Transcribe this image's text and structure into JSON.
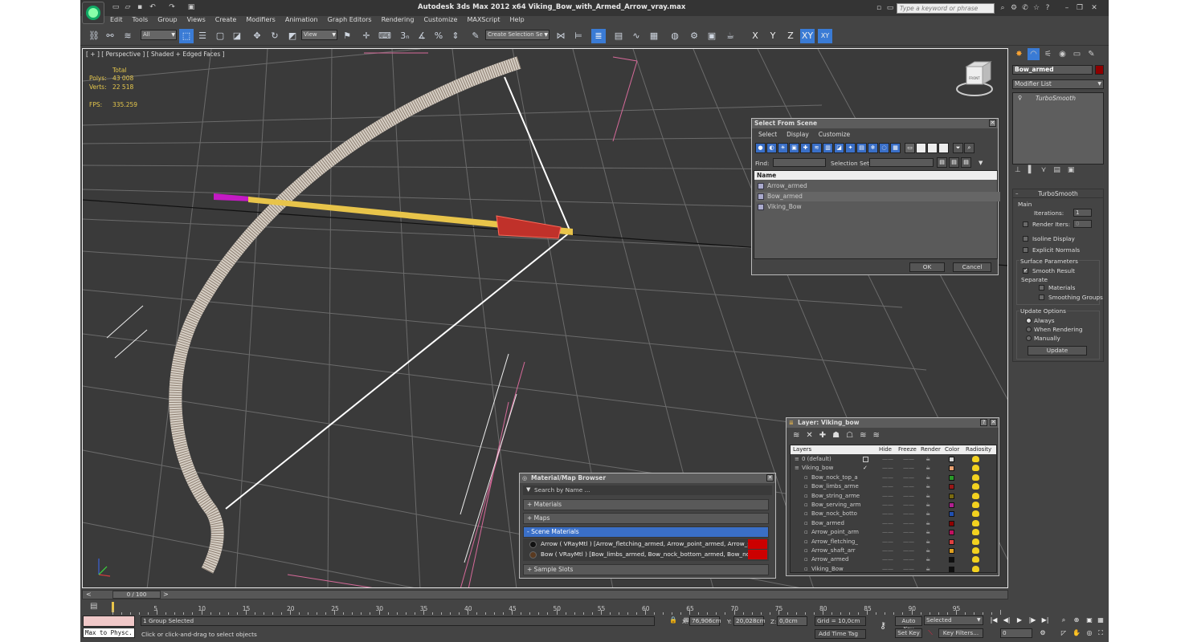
{
  "title": "Autodesk 3ds Max  2012 x64     Viking_Bow_with_Armed_Arrow_vray.max",
  "search_placeholder": "Type a keyword or phrase",
  "menu": [
    "Edit",
    "Tools",
    "Group",
    "Views",
    "Create",
    "Modifiers",
    "Animation",
    "Graph Editors",
    "Rendering",
    "Customize",
    "MAXScript",
    "Help"
  ],
  "toolbar": {
    "selection_filter": "All",
    "ref_coord": "View",
    "named_selection": "Create Selection Se",
    "axes": [
      "X",
      "Y",
      "Z",
      "XY",
      "XY"
    ]
  },
  "viewport": {
    "label": "[ + ] [ Perspective ] [ Shaded + Edged Faces ]",
    "stats_header": "Total",
    "polys_label": "Polys:",
    "polys_value": "43 008",
    "verts_label": "Verts:",
    "verts_value": "22 518",
    "fps_label": "FPS:",
    "fps_value": "335.259",
    "viewcube_label": "FRONT"
  },
  "command_panel": {
    "object_name": "Bow_armed",
    "object_color": "#8e0000",
    "modifier_list": "Modifier List",
    "stack_item": "TurboSmooth",
    "rollout_title": "TurboSmooth",
    "main": "Main",
    "iterations_label": "Iterations:",
    "iterations_value": "1",
    "render_iters_label": "Render Iters:",
    "render_iters_value": "0",
    "isoline": "Isoline Display",
    "explicit": "Explicit Normals",
    "surface_params": "Surface Parameters",
    "smooth_result": "Smooth Result",
    "separate": "Separate",
    "materials": "Materials",
    "smoothing_groups": "Smoothing Groups",
    "update_options": "Update Options",
    "always": "Always",
    "when_rendering": "When Rendering",
    "manually": "Manually",
    "update_button": "Update"
  },
  "select_from_scene": {
    "title": "Select From Scene",
    "menu": [
      "Select",
      "Display",
      "Customize"
    ],
    "find_label": "Find:",
    "selection_set_label": "Selection Set:",
    "name_header": "Name",
    "items": [
      "Arrow_armed",
      "Bow_armed",
      "Viking_Bow"
    ],
    "ok": "OK",
    "cancel": "Cancel"
  },
  "layer_dialog": {
    "title": "Layer: Viking_bow",
    "headers": [
      "Layers",
      "Hide",
      "Freeze",
      "Render",
      "Color",
      "Radiosity"
    ],
    "rows": [
      {
        "name": "0 (default)",
        "color": "#d4d4d4",
        "dash": "——"
      },
      {
        "name": "Viking_bow",
        "color": "#e8a070",
        "dash": "——"
      },
      {
        "name": "Bow_nock_top_a",
        "color": "#2a9a2a",
        "dash": "——"
      },
      {
        "name": "Bow_limbs_arme",
        "color": "#9a1818",
        "dash": "——"
      },
      {
        "name": "Bow_string_arme",
        "color": "#7a6a10",
        "dash": "——"
      },
      {
        "name": "Bow_serving_arm",
        "color": "#b02090",
        "dash": "——"
      },
      {
        "name": "Bow_nock_botto",
        "color": "#2050b0",
        "dash": "——"
      },
      {
        "name": "Bow_armed",
        "color": "#8e0000",
        "dash": "——"
      },
      {
        "name": "Arrow_point_arm",
        "color": "#c01060",
        "dash": "——"
      },
      {
        "name": "Arrow_fletching_",
        "color": "#e04040",
        "dash": "——"
      },
      {
        "name": "Arrow_shaft_arr",
        "color": "#e0a020",
        "dash": "——"
      },
      {
        "name": "Arrow_armed",
        "color": "#101010",
        "dash": "——"
      },
      {
        "name": "Viking_Bow",
        "color": "#101010",
        "dash": "——"
      }
    ]
  },
  "material_browser": {
    "title": "Material/Map Browser",
    "search": "Search by Name ...",
    "materials": "+ Materials",
    "maps": "+ Maps",
    "scene_materials": "- Scene Materials",
    "mat1": "Arrow  ( VRayMtl )  [Arrow_fletching_armed, Arrow_point_armed, Arrow_shaft_a...",
    "mat2": "Bow  ( VRayMtl )  [Bow_limbs_armed, Bow_nock_bottom_armed, Bow_nock_top...",
    "sample_slots": "+ Sample Slots"
  },
  "timeline": {
    "slider": "0 / 100",
    "ticks": [
      "5",
      "10",
      "15",
      "20",
      "25",
      "30",
      "35",
      "40",
      "45",
      "50",
      "55",
      "60",
      "65",
      "70",
      "75",
      "80",
      "85",
      "90",
      "95"
    ]
  },
  "status": {
    "listener": "Max to Physc.",
    "selection": "1 Group Selected",
    "prompt": "Click or click-and-drag to select objects",
    "x_label": "X:",
    "x_value": "76,906cm",
    "y_label": "Y:",
    "y_value": "20,028cm",
    "z_label": "Z:",
    "z_value": "0,0cm",
    "grid": "Grid = 10,0cm",
    "add_time_tag": "Add Time Tag",
    "auto_key": "Auto Key",
    "set_key": "Set Key",
    "selected": "Selected",
    "key_filters": "Key Filters...",
    "frame": "0"
  }
}
